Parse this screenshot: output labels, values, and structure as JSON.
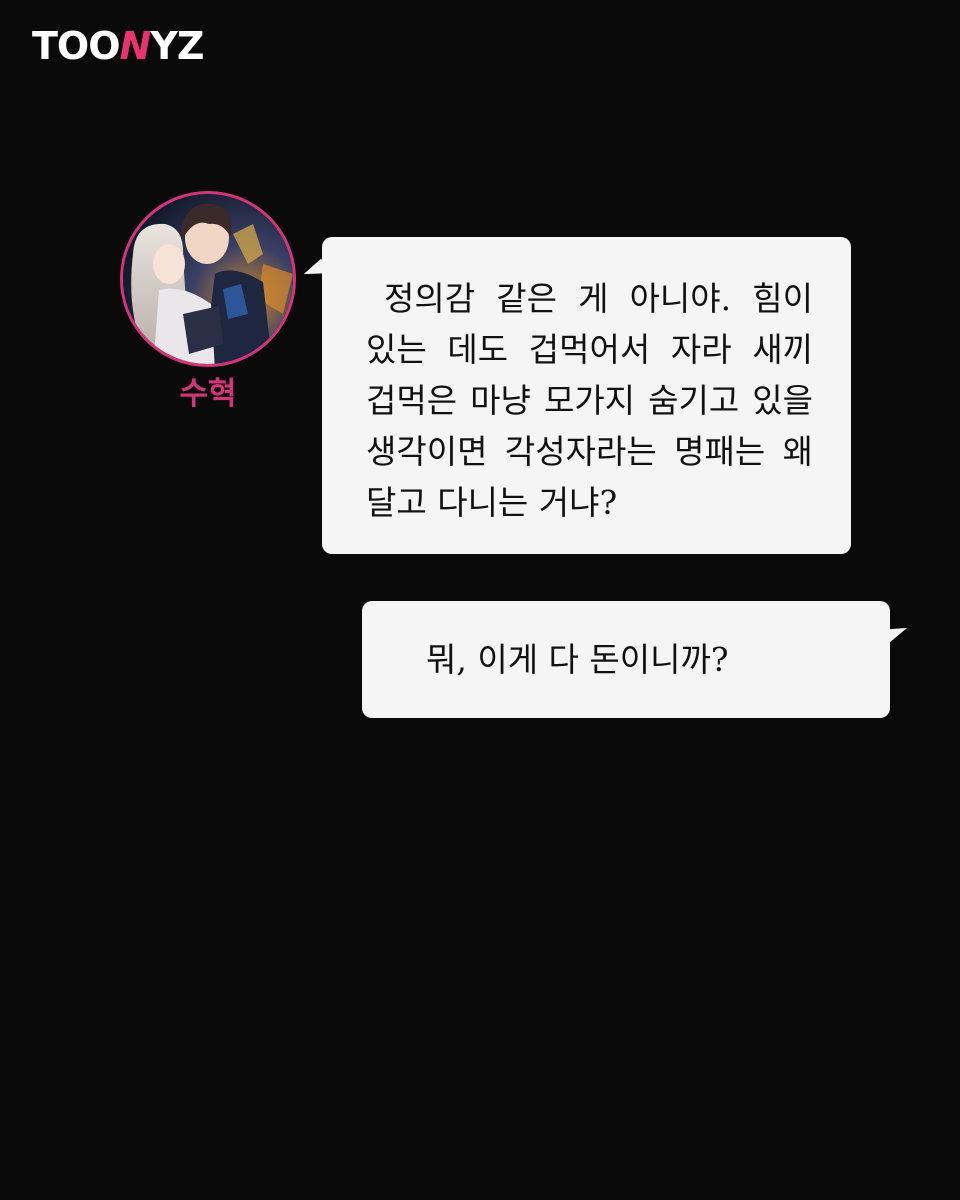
{
  "brand": {
    "logo_pre": "TOO",
    "logo_accent": "N",
    "logo_post": "YZ",
    "accent_color": "#e8336f"
  },
  "speaker": {
    "name": "수혁",
    "name_color": "#d6337b",
    "avatar_icon": "character-portrait"
  },
  "messages": [
    {
      "text": "정의감 같은 게 아니야. 힘이 있는 데도 겁먹어서 자라 새끼 겁먹은 마냥 모가지 숨기고 있을 생각이면 각성자라는 명패는 왜 달고 다니는 거냐?",
      "side": "left"
    },
    {
      "text": "뭐, 이게 다 돈이니까?",
      "side": "right"
    }
  ],
  "colors": {
    "background": "#0a0a0a",
    "bubble": "#f5f5f5",
    "text": "#111111"
  }
}
